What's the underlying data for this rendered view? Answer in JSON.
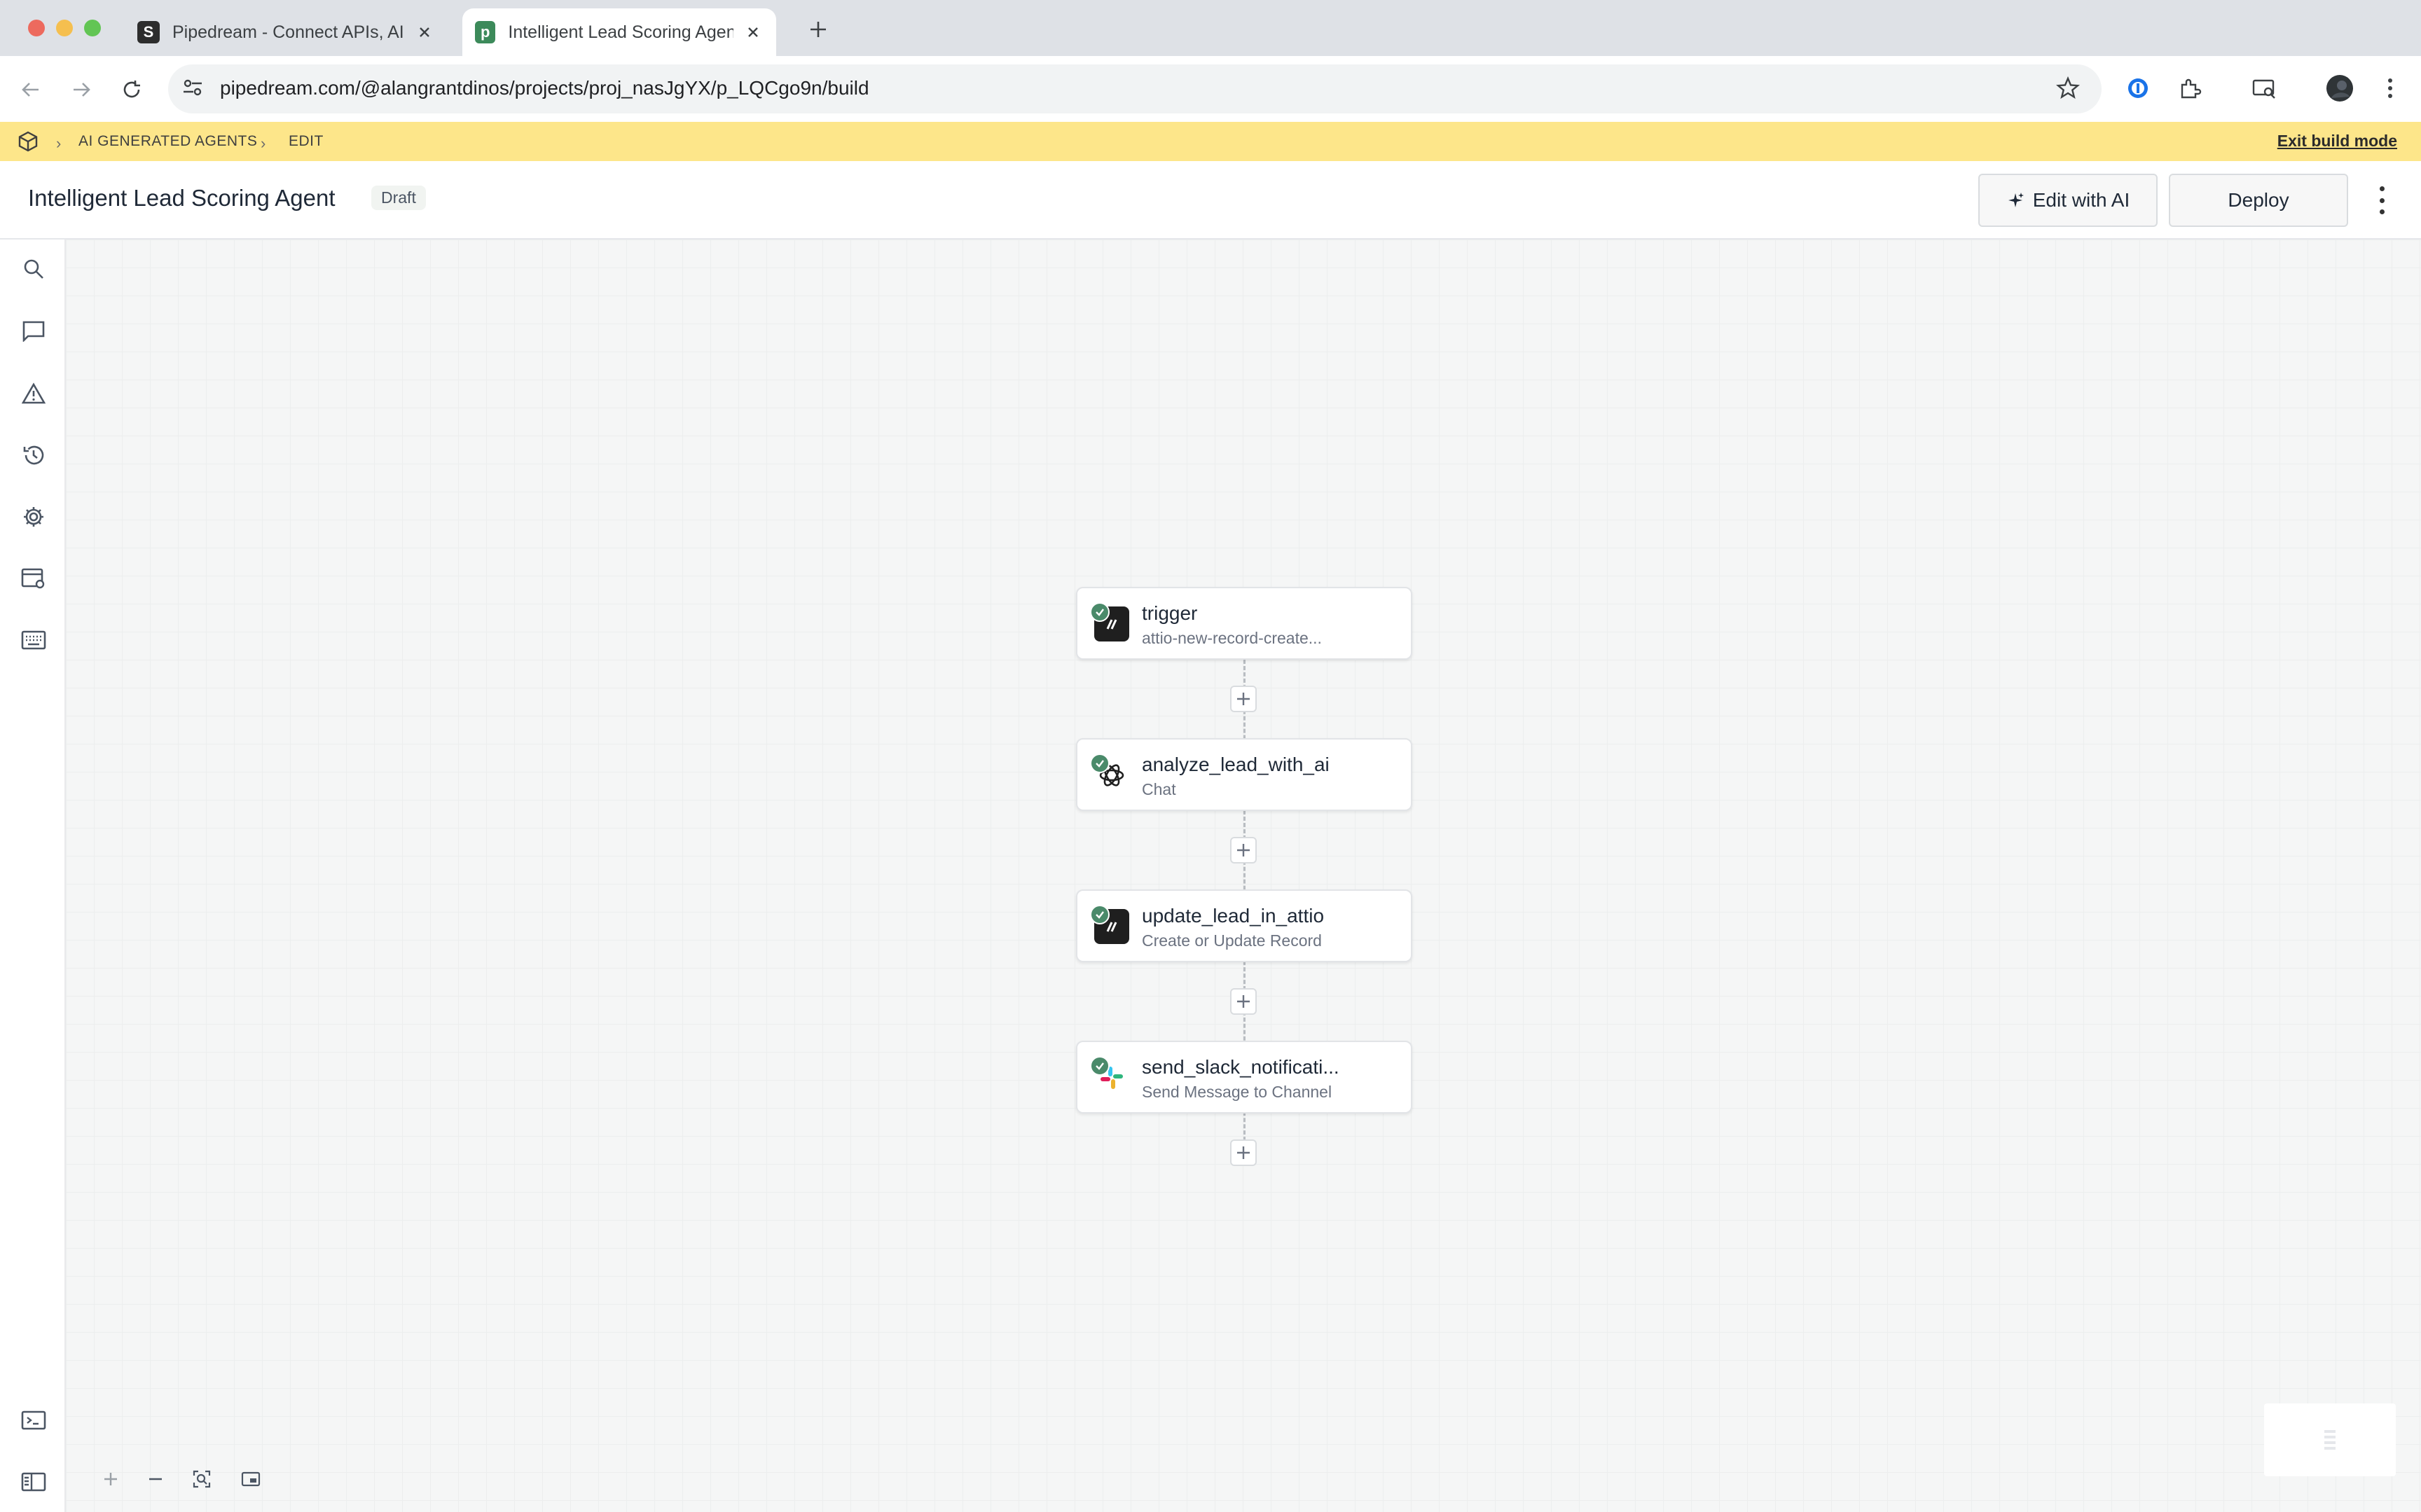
{
  "browser": {
    "tabs": [
      {
        "favicon": "S",
        "title": "Pipedream - Connect APIs, AI",
        "active": false
      },
      {
        "favicon": "p",
        "title": "Intelligent Lead Scoring Agent",
        "active": true
      }
    ],
    "url": "pipedream.com/@alangrantdinos/projects/proj_nasJgYX/p_LQCgo9n/build"
  },
  "build_bar": {
    "breadcrumb": [
      "AI GENERATED AGENTS",
      "EDIT"
    ],
    "exit_label": "Exit build mode",
    "color": "#fde68a"
  },
  "header": {
    "title": "Intelligent Lead Scoring Agent",
    "status_badge": "Draft",
    "edit_ai_label": "Edit with AI",
    "deploy_label": "Deploy"
  },
  "sidebar": {
    "icons": [
      "search-icon",
      "comment-icon",
      "warning-icon",
      "history-icon",
      "gear-icon",
      "window-settings-icon",
      "keyboard-icon",
      "terminal-icon",
      "panel-icon"
    ]
  },
  "workflow": {
    "steps": [
      {
        "title": "trigger",
        "subtitle": "attio-new-record-create...",
        "app": "attio",
        "status": "success"
      },
      {
        "title": "analyze_lead_with_ai",
        "subtitle": "Chat",
        "app": "openai",
        "status": "success"
      },
      {
        "title": "update_lead_in_attio",
        "subtitle": "Create or Update Record",
        "app": "attio",
        "status": "success"
      },
      {
        "title": "send_slack_notificati...",
        "subtitle": "Send Message to Channel",
        "app": "slack",
        "status": "success"
      }
    ]
  },
  "canvas_controls": [
    "zoom-in-icon",
    "zoom-out-icon",
    "fit-view-icon",
    "minimap-toggle-icon"
  ],
  "colors": {
    "success": "#4a8a6a",
    "accent": "#3c8a5a"
  }
}
